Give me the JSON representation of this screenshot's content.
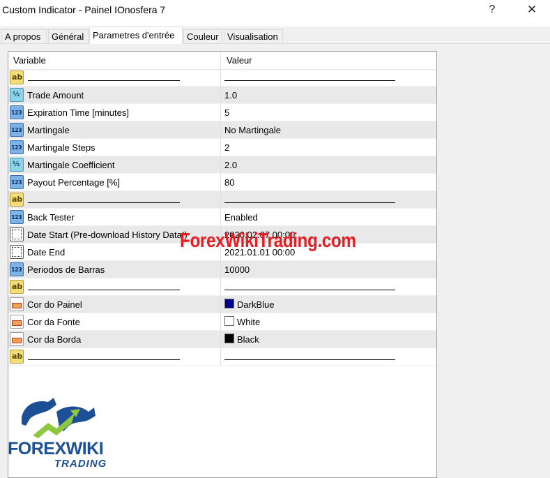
{
  "window": {
    "title": "Custom Indicator - Painel IOnosfera 7",
    "help_glyph": "?",
    "close_glyph": "✕"
  },
  "tabs": [
    {
      "label": "A propos"
    },
    {
      "label": "Général"
    },
    {
      "label": "Parametres d'entrée",
      "active": true
    },
    {
      "label": "Couleur"
    },
    {
      "label": "Visualisation"
    }
  ],
  "grid": {
    "headers": {
      "variable": "Variable",
      "value": "Valeur"
    },
    "rows": [
      {
        "icon": "ab-icon",
        "variable": "",
        "value": "",
        "separator": true
      },
      {
        "icon": "fraction-icon",
        "variable": "Trade Amount",
        "value": "1.0"
      },
      {
        "icon": "integer-icon",
        "variable": "Expiration Time [minutes]",
        "value": "5"
      },
      {
        "icon": "integer-icon",
        "variable": "Martingale",
        "value": "No Martingale"
      },
      {
        "icon": "integer-icon",
        "variable": "Martingale Steps",
        "value": "2"
      },
      {
        "icon": "fraction-icon",
        "variable": "Martingale Coefficient",
        "value": "2.0"
      },
      {
        "icon": "integer-icon",
        "variable": "Payout Percentage [%]",
        "value": "80"
      },
      {
        "icon": "ab-icon",
        "variable": "",
        "value": "",
        "separator": true
      },
      {
        "icon": "integer-icon",
        "variable": "Back Tester",
        "value": "Enabled"
      },
      {
        "icon": "date-icon",
        "variable": "Date Start (Pre-download History Data!)",
        "value": "2020.02.07 00:00"
      },
      {
        "icon": "date-icon",
        "variable": "Date End",
        "value": "2021.01.01 00:00"
      },
      {
        "icon": "integer-icon",
        "variable": "Periodos de Barras",
        "value": "10000"
      },
      {
        "icon": "ab-icon",
        "variable": "",
        "value": "",
        "separator": true
      },
      {
        "icon": "color-icon",
        "variable": "Cor do Painel",
        "value": "DarkBlue",
        "swatch": "#00008b"
      },
      {
        "icon": "color-icon",
        "variable": "Cor da Fonte",
        "value": "White",
        "swatch": "#ffffff"
      },
      {
        "icon": "color-icon",
        "variable": "Cor da Borda",
        "value": "Black",
        "swatch": "#000000"
      },
      {
        "icon": "ab-icon",
        "variable": "",
        "value": "",
        "separator": true
      }
    ]
  },
  "icon_glyphs": {
    "ab": "ab",
    "fraction": "½",
    "integer": "123"
  },
  "watermark": {
    "text": "ForexWikiTrading.com"
  },
  "logo": {
    "line1": "FOREXWIKI",
    "line2": "TRADING"
  }
}
